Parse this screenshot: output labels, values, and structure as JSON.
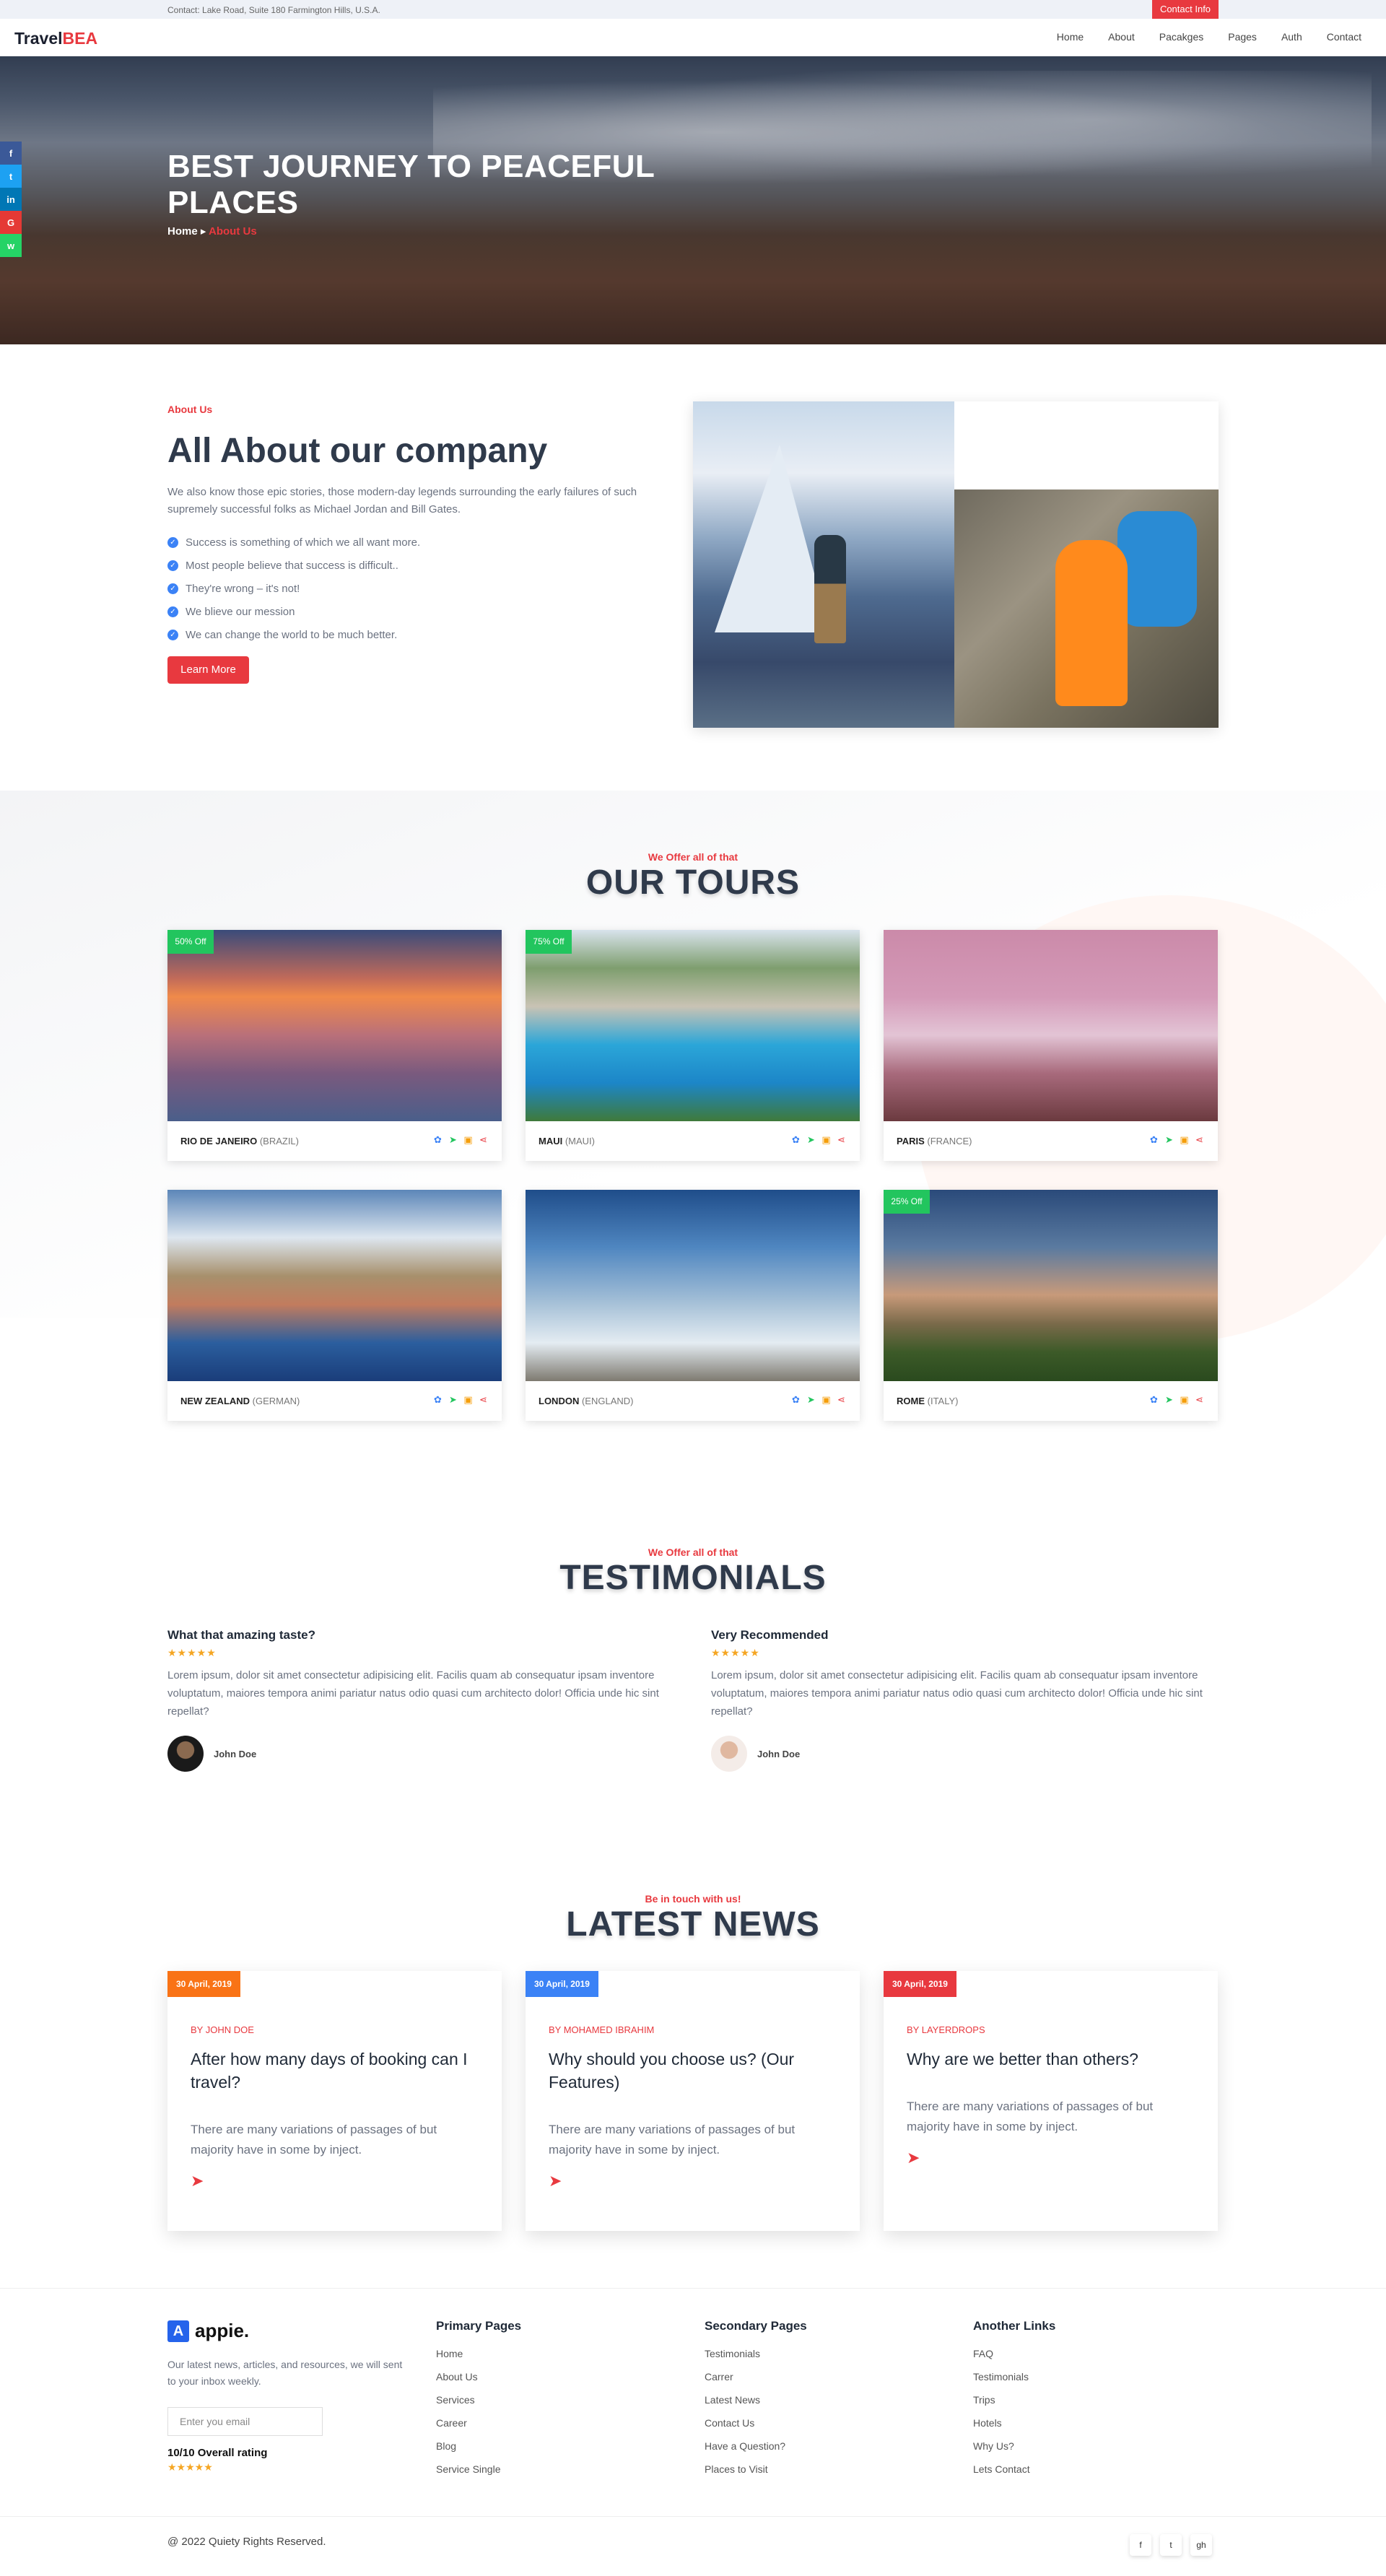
{
  "topbar": {
    "address": "Contact: Lake Road, Suite 180 Farmington Hills, U.S.A.",
    "contact_btn": "Contact Info"
  },
  "header": {
    "logo_a": "Travel",
    "logo_b": "BEA",
    "nav": [
      "Home",
      "About",
      "Pacakges",
      "Pages",
      "Auth",
      "Contact"
    ]
  },
  "hero": {
    "title": "BEST JOURNEY TO PEACEFUL PLACES",
    "crumb_home": "Home",
    "crumb_sep": "▸",
    "crumb_current": "About Us"
  },
  "social": {
    "items": [
      "f",
      "t",
      "in",
      "G",
      "w"
    ],
    "colors": [
      "#3b5998",
      "#1da1f2",
      "#0077b5",
      "#e53935",
      "#25d366"
    ]
  },
  "about": {
    "label": "About Us",
    "title": "All About our company",
    "desc": "We also know those epic stories, those modern-day legends surrounding the early failures of such supremely successful folks as Michael Jordan and Bill Gates.",
    "checks": [
      "Success is something of which we all want more.",
      "Most people believe that success is difficult..",
      "They're wrong – it's not!",
      "We blieve our mession",
      "We can change the world to be much better."
    ],
    "button": "Learn More"
  },
  "tours": {
    "label": "We Offer all of that",
    "title": "OUR TOURS",
    "items": [
      {
        "name": "RIO DE JANEIRO",
        "sub": "(BRAZIL)",
        "off": "50% Off"
      },
      {
        "name": "MAUI",
        "sub": "(MAUI)",
        "off": "75% Off"
      },
      {
        "name": "PARIS",
        "sub": "(FRANCE)",
        "off": ""
      },
      {
        "name": "NEW ZEALAND",
        "sub": "(GERMAN)",
        "off": ""
      },
      {
        "name": "LONDON",
        "sub": "(ENGLAND)",
        "off": ""
      },
      {
        "name": "ROME",
        "sub": "(ITALY)",
        "off": "25% Off"
      }
    ]
  },
  "testimonials": {
    "label": "We Offer all of that",
    "title": "TESTIMONIALS",
    "items": [
      {
        "title": "What that amazing taste?",
        "stars": "★★★★★",
        "text": "Lorem ipsum, dolor sit amet consectetur adipisicing elit. Facilis quam ab consequatur ipsam inventore voluptatum, maiores tempora animi pariatur natus odio quasi cum architecto dolor! Officia unde hic sint repellat?",
        "author": "John Doe"
      },
      {
        "title": "Very Recommended",
        "stars": "★★★★★",
        "text": "Lorem ipsum, dolor sit amet consectetur adipisicing elit. Facilis quam ab consequatur ipsam inventore voluptatum, maiores tempora animi pariatur natus odio quasi cum architecto dolor! Officia unde hic sint repellat?",
        "author": "John Doe"
      }
    ]
  },
  "news": {
    "label": "Be in touch with us!",
    "title": "LATEST NEWS",
    "items": [
      {
        "date": "30 April, 2019",
        "by": "BY JOHN DOE",
        "title": "After how many days of booking can I travel?",
        "desc": "There are many variations of passages of but majority have in some by inject.",
        "color": "#f97316"
      },
      {
        "date": "30 April, 2019",
        "by": "BY MOHAMED IBRAHIM",
        "title": "Why should you choose us? (Our Features)",
        "desc": "There are many variations of passages of but majority have in some by inject.",
        "color": "#3b82f6"
      },
      {
        "date": "30 April, 2019",
        "by": "BY LAYERDROPS",
        "title": "Why are we better than others?",
        "desc": "There are many variations of passages of but majority have in some by inject.",
        "color": "#e8393f"
      }
    ]
  },
  "footer": {
    "logo": "appie.",
    "logo_mark": "A",
    "desc": "Our latest news, articles, and resources, we will sent to your inbox weekly.",
    "email_placeholder": "Enter you email",
    "rating": "10/10 Overall rating",
    "stars": "★★★★★",
    "cols": [
      {
        "title": "Primary Pages",
        "links": [
          "Home",
          "About Us",
          "Services",
          "Career",
          "Blog",
          "Service Single"
        ]
      },
      {
        "title": "Secondary Pages",
        "links": [
          "Testimonials",
          "Carrer",
          "Latest News",
          "Contact Us",
          "Have a Question?",
          "Places to Visit"
        ]
      },
      {
        "title": "Another Links",
        "links": [
          "FAQ",
          "Testimonials",
          "Trips",
          "Hotels",
          "Why Us?",
          "Lets Contact"
        ]
      }
    ],
    "copyright": "@ 2022 Quiety Rights Reserved.",
    "icons": [
      "f",
      "t",
      "gh"
    ]
  }
}
